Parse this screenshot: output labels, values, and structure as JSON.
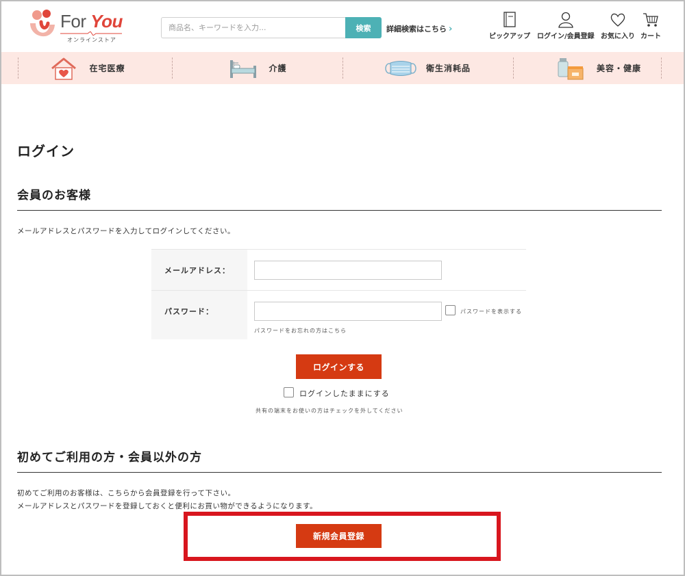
{
  "header": {
    "logo": {
      "brand_for": "For",
      "brand_you": "You",
      "subtitle": "オンラインストア"
    },
    "search": {
      "placeholder": "商品名、キーワードを入力...",
      "value": "",
      "button_label": "検索"
    },
    "advanced_search_label": "詳細検索はこちら",
    "nav": [
      {
        "icon": "book-icon",
        "label": "ピックアップ"
      },
      {
        "icon": "user-icon",
        "label": "ログイン/会員登録"
      },
      {
        "icon": "heart-icon",
        "label": "お気に入り"
      },
      {
        "icon": "cart-icon",
        "label": "カート"
      }
    ]
  },
  "categories": [
    {
      "icon": "house-heart-icon",
      "label": "在宅医療"
    },
    {
      "icon": "bed-icon",
      "label": "介護"
    },
    {
      "icon": "mask-icon",
      "label": "衛生消耗品"
    },
    {
      "icon": "bottle-box-icon",
      "label": "美容・健康"
    }
  ],
  "login": {
    "page_title": "ログイン",
    "member_section_title": "会員のお客様",
    "instructions": "メールアドレスとパスワードを入力してログインしてください。",
    "email_label": "メールアドレス：",
    "email_value": "",
    "password_label": "パスワード：",
    "password_value": "",
    "show_password_label": "パスワードを表示する",
    "forgot_password_link": "パスワードをお忘れの方はこちら",
    "login_button": "ログインする",
    "keep_logged_in_label": "ログインしたままにする",
    "shared_device_note": "共有の端末をお使いの方はチェックを外してください"
  },
  "guest": {
    "section_title": "初めてご利用の方・会員以外の方",
    "line1": "初めてご利用のお客様は、こちらから会員登録を行って下さい。",
    "line2": "メールアドレスとパスワードを登録しておくと便利にお買い物ができるようになります。",
    "register_button": "新規会員登録"
  },
  "colors": {
    "accent_teal": "#4db1b5",
    "brand_red": "#d53a12",
    "category_bar": "#fde8e3",
    "highlight_red": "#d8161e"
  }
}
